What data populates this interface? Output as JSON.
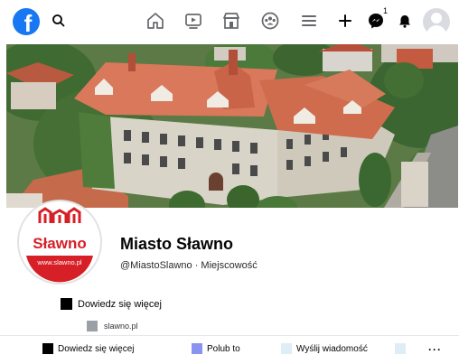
{
  "topnav": {
    "logo_letter": "f",
    "icons": [
      "facebook-logo",
      "search-icon",
      "home-icon",
      "watch-icon",
      "marketplace-icon",
      "groups-icon",
      "menu-icon",
      "plus-icon",
      "messenger-icon",
      "notifications-icon",
      "account-avatar"
    ],
    "messenger_badge": "1"
  },
  "profile": {
    "avatar_text": "Sławno",
    "avatar_url": "www.slawno.pl",
    "name": "Miasto Sławno",
    "subtitle": "@MiastoSlawno · Miejscowość",
    "learn_more": "Dowiedz się więcej",
    "website": "slawno.pl"
  },
  "actions": {
    "learn_more": "Dowiedz się więcej",
    "like": "Polub to",
    "message": "Wyślij wiadomość",
    "more": "···"
  },
  "colors": {
    "brand": "#1877f2",
    "logo_red": "#d61f26",
    "like_square": "#8b93f0",
    "message_square": "#dfeef6",
    "extra_square": "#dfeef6"
  }
}
